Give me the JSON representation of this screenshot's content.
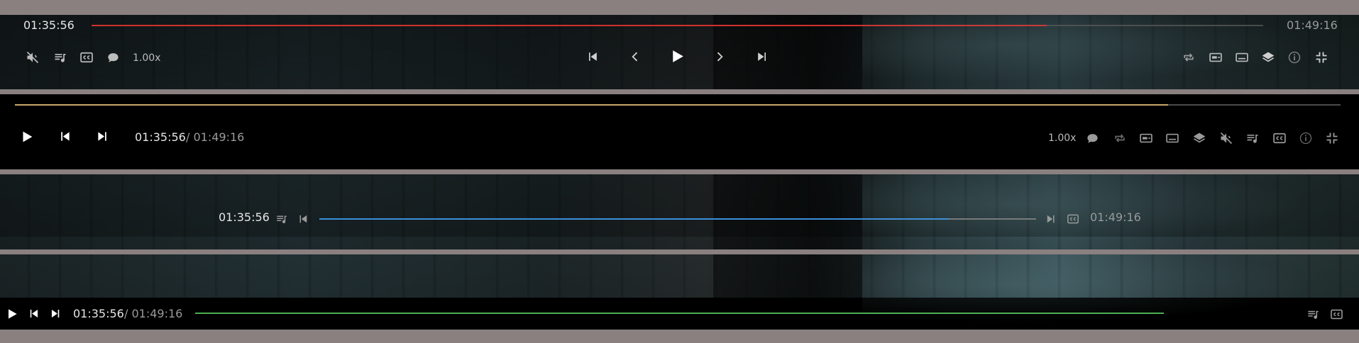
{
  "players": [
    {
      "id": "player-1",
      "current_time": "01:35:56",
      "duration": "01:49:16",
      "progress": 0.815,
      "progress_color": "#d0312d",
      "speed": "1.00x"
    },
    {
      "id": "player-2",
      "current_time": "01:35:56",
      "separator_duration": "/ 01:49:16",
      "progress": 0.87,
      "progress_color": "#c8a86a",
      "speed": "1.00x"
    },
    {
      "id": "player-3",
      "current_time": "01:35:56",
      "duration": "01:49:16",
      "progress": 0.878,
      "progress_color": "#3b8fdc"
    },
    {
      "id": "player-4",
      "current_time": "01:35:56",
      "separator_duration": "/ 01:49:16",
      "progress": 1.0,
      "progress_color": "#4caf50"
    }
  ],
  "icons": {
    "mute": "volume-off-icon",
    "playlist": "playlist-icon",
    "cc": "closed-captions-icon",
    "chat": "chat-bubble-icon",
    "prev": "skip-previous-icon",
    "back": "chevron-left-icon",
    "play": "play-icon",
    "forward": "chevron-right-icon",
    "next": "skip-next-icon",
    "loop": "loop-icon",
    "pip": "picture-in-picture-icon",
    "subtitles": "subtitles-icon",
    "layers": "layers-icon",
    "info": "info-icon",
    "exit_fullscreen": "exit-fullscreen-icon"
  }
}
